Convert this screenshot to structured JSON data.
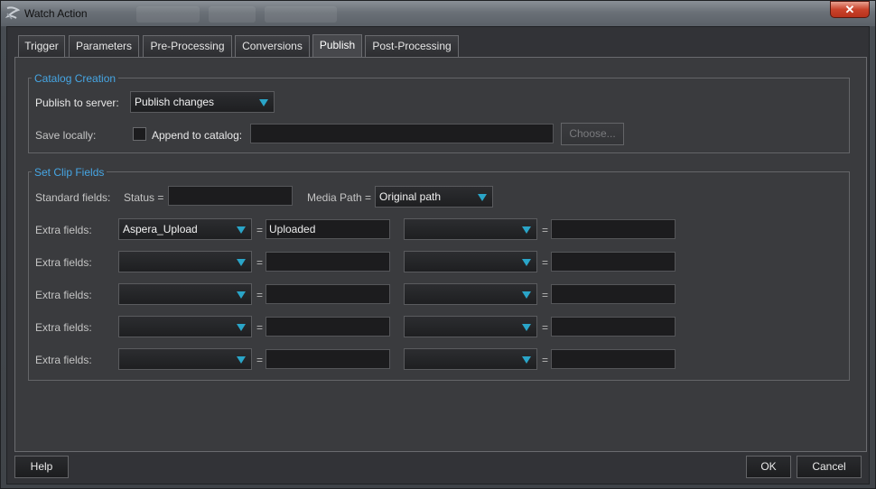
{
  "window": {
    "title": "Watch Action",
    "close_label": "✕"
  },
  "tabs": [
    {
      "label": "Trigger"
    },
    {
      "label": "Parameters"
    },
    {
      "label": "Pre-Processing"
    },
    {
      "label": "Conversions"
    },
    {
      "label": "Publish",
      "active": true
    },
    {
      "label": "Post-Processing"
    }
  ],
  "catalog_creation": {
    "legend": "Catalog Creation",
    "publish_label": "Publish to server:",
    "publish_value": "Publish changes",
    "save_locally_label": "Save locally:",
    "append_label": "Append to catalog:",
    "append_value": "",
    "choose_label": "Choose..."
  },
  "clip_fields": {
    "legend": "Set Clip Fields",
    "standard_label": "Standard fields:",
    "status_label": "Status =",
    "status_value": "",
    "media_path_label": "Media Path =",
    "media_path_value": "Original path",
    "extra_label": "Extra fields:",
    "eq": "=",
    "rows": [
      {
        "field1": "Aspera_Upload",
        "value1": "Uploaded",
        "field2": "",
        "value2": ""
      },
      {
        "field1": "",
        "value1": "",
        "field2": "",
        "value2": ""
      },
      {
        "field1": "",
        "value1": "",
        "field2": "",
        "value2": ""
      },
      {
        "field1": "",
        "value1": "",
        "field2": "",
        "value2": ""
      },
      {
        "field1": "",
        "value1": "",
        "field2": "",
        "value2": ""
      }
    ]
  },
  "footer": {
    "help_label": "Help",
    "ok_label": "OK",
    "cancel_label": "Cancel"
  },
  "colors": {
    "accent_legend": "#46a6e4",
    "dropdown_caret": "#2aa5c8",
    "close_button": "#c9432b"
  }
}
